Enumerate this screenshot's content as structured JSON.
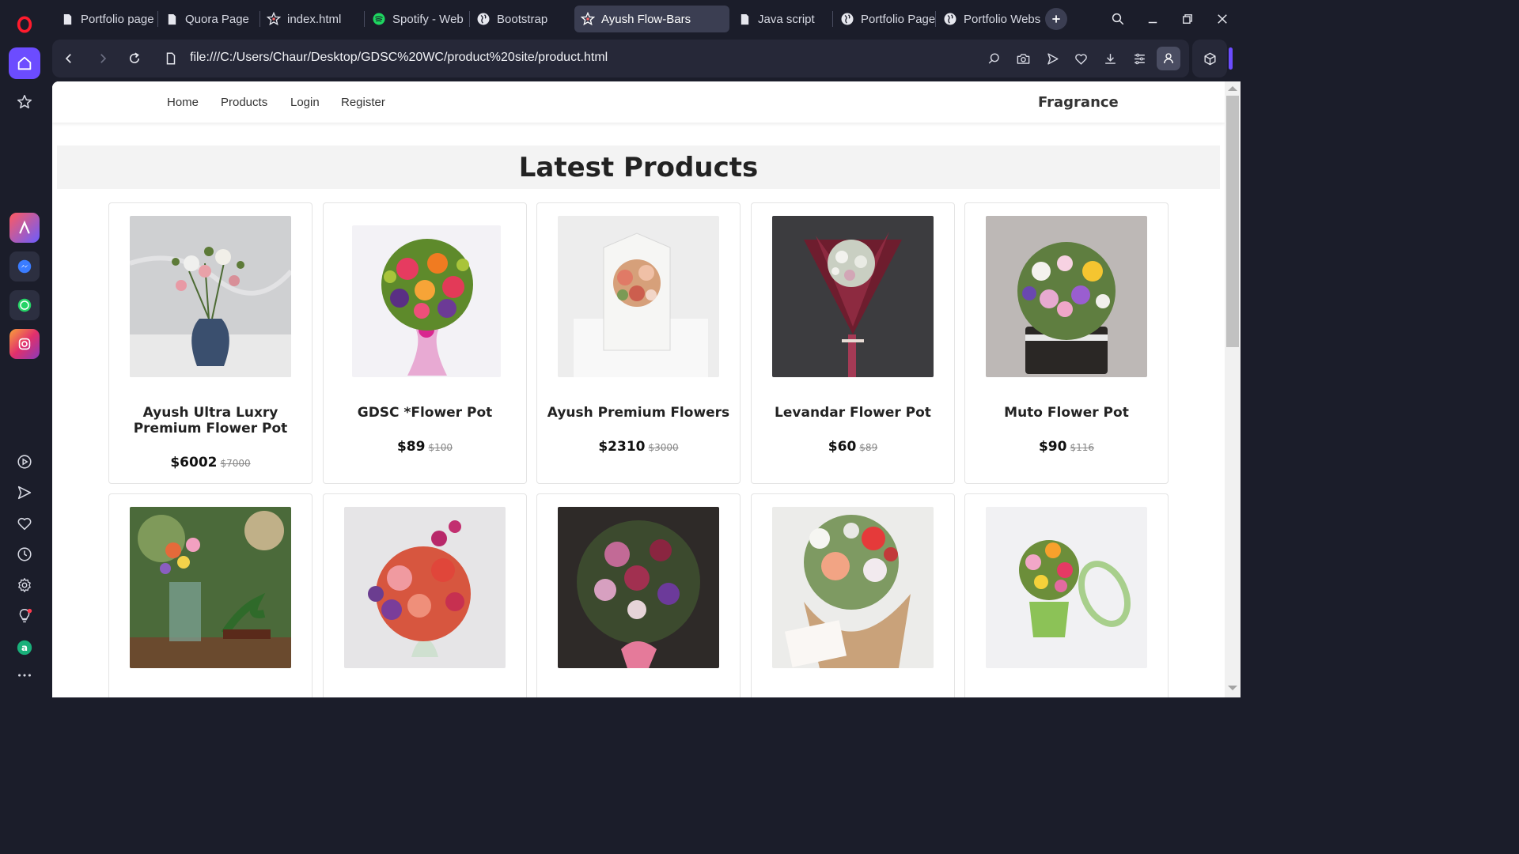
{
  "browser": {
    "tabs": [
      {
        "title": "Portfolio page",
        "icon": "document-icon"
      },
      {
        "title": "Quora Page",
        "icon": "document-icon"
      },
      {
        "title": "index.html",
        "icon": "star-badge-icon"
      },
      {
        "title": "Spotify - Web",
        "icon": "spotify-icon"
      },
      {
        "title": "Bootstrap",
        "icon": "globe-icon"
      },
      {
        "title": "Ayush Flow-Bars",
        "icon": "star-badge-icon",
        "active": true
      },
      {
        "title": "Java script",
        "icon": "document-icon"
      },
      {
        "title": "Portfolio Page",
        "icon": "globe-icon"
      },
      {
        "title": "Portfolio Webs",
        "icon": "globe-icon"
      }
    ],
    "url": "file:///C:/Users/Chaur/Desktop/GDSC%20WC/product%20site/product.html",
    "accent_color": "#6c4cff"
  },
  "site": {
    "nav": {
      "home": "Home",
      "products": "Products",
      "login": "Login",
      "register": "Register",
      "brand": "Fragrance"
    },
    "heading": "Latest Products",
    "products": [
      {
        "name": "Ayush Ultra Luxry Premium Flower Pot",
        "price": "$6002",
        "old_price": "$7000"
      },
      {
        "name": "GDSC *Flower Pot",
        "price": "$89",
        "old_price": "$100"
      },
      {
        "name": "Ayush Premium Flowers",
        "price": "$2310",
        "old_price": "$3000"
      },
      {
        "name": "Levandar Flower Pot",
        "price": "$60",
        "old_price": "$89"
      },
      {
        "name": "Muto Flower Pot",
        "price": "$90",
        "old_price": "$116"
      }
    ]
  }
}
